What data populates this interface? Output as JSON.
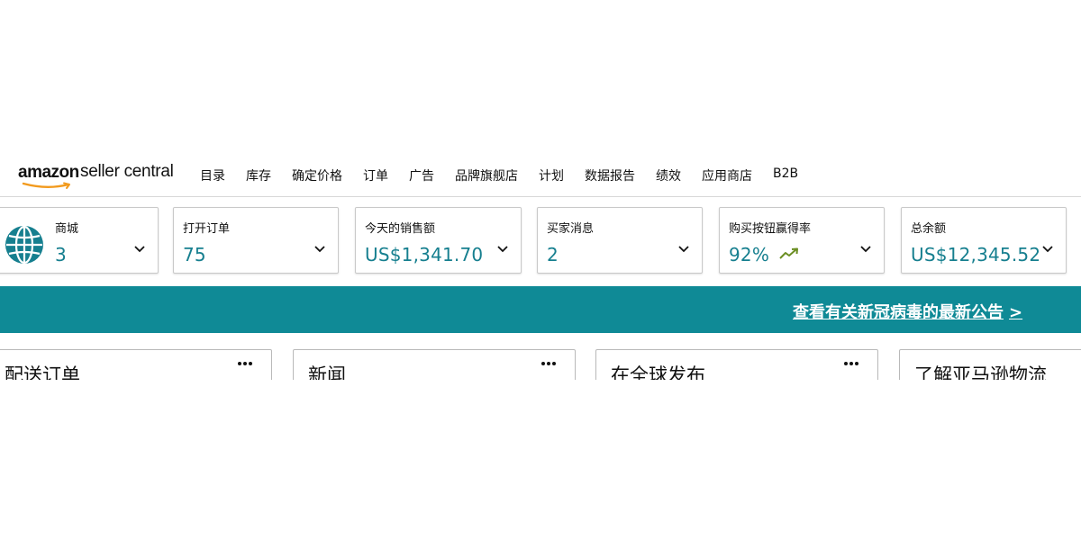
{
  "logo": {
    "brand": "amazon",
    "product": "seller central"
  },
  "nav": {
    "items": [
      "目录",
      "库存",
      "确定价格",
      "订单",
      "广告",
      "品牌旗舰店",
      "计划",
      "数据报告",
      "绩效",
      "应用商店",
      "B2B"
    ]
  },
  "cards": [
    {
      "label": "商城",
      "value": "3",
      "icon": "globe-icon"
    },
    {
      "label": "打开订单",
      "value": "75"
    },
    {
      "label": "今天的销售额",
      "value": "US$1,341.70"
    },
    {
      "label": "买家消息",
      "value": "2"
    },
    {
      "label": "购买按钮赢得率",
      "value": "92%",
      "icon": "trend-up-icon"
    },
    {
      "label": "总余额",
      "value": "US$12,345.52"
    }
  ],
  "banner": {
    "text": "查看有关新冠病毒的最新公告",
    "arrow": ">"
  },
  "widgets": [
    {
      "title": "配送订单"
    },
    {
      "title": "新闻"
    },
    {
      "title": "在全球发布"
    },
    {
      "title": "了解亚马逊物流"
    }
  ],
  "colors": {
    "accent": "#167f8f",
    "banner": "#0f8a96",
    "trend": "#6b8e23",
    "logo_smile": "#f29a1d"
  }
}
